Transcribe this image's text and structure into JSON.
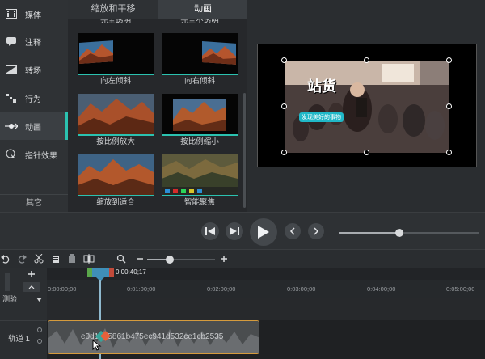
{
  "sidebar": {
    "items": [
      {
        "label": "媒体",
        "icon": "film-icon"
      },
      {
        "label": "注释",
        "icon": "annotation-icon"
      },
      {
        "label": "转场",
        "icon": "transition-icon"
      },
      {
        "label": "行为",
        "icon": "behavior-icon"
      },
      {
        "label": "动画",
        "icon": "animation-icon"
      },
      {
        "label": "指针效果",
        "icon": "cursor-effect-icon"
      }
    ],
    "active_index": 4,
    "other_label": "其它"
  },
  "library": {
    "tabs": [
      "缩放和平移",
      "动画"
    ],
    "active_tab": 1,
    "top_partial_captions": [
      "完全透明",
      "完全不透明"
    ],
    "tiles": [
      {
        "caption": "向左倾斜"
      },
      {
        "caption": "向右倾斜"
      },
      {
        "caption": "按比例放大"
      },
      {
        "caption": "按比例缩小"
      },
      {
        "caption": "缩放到适合"
      },
      {
        "caption": "智能聚焦"
      }
    ]
  },
  "canvas": {
    "overlay_text": "站货",
    "overlay_sub": "发现美好的事物"
  },
  "timeline": {
    "playhead_time": "0:00:40;17",
    "ruler_ticks": [
      "0:00:00;00",
      "0:01:00;00",
      "0:02:00;00",
      "0:03:00;00",
      "0:04:00;00",
      "0:05:00;00"
    ],
    "track_group": "测验",
    "track_name": "轨道 1",
    "clip_name": "e0d1615861b475ec941d532ce1cb2535"
  },
  "colors": {
    "accent": "#2bc2b0",
    "clip_border": "#d59b3d",
    "playhead": "#3f8fb8"
  }
}
